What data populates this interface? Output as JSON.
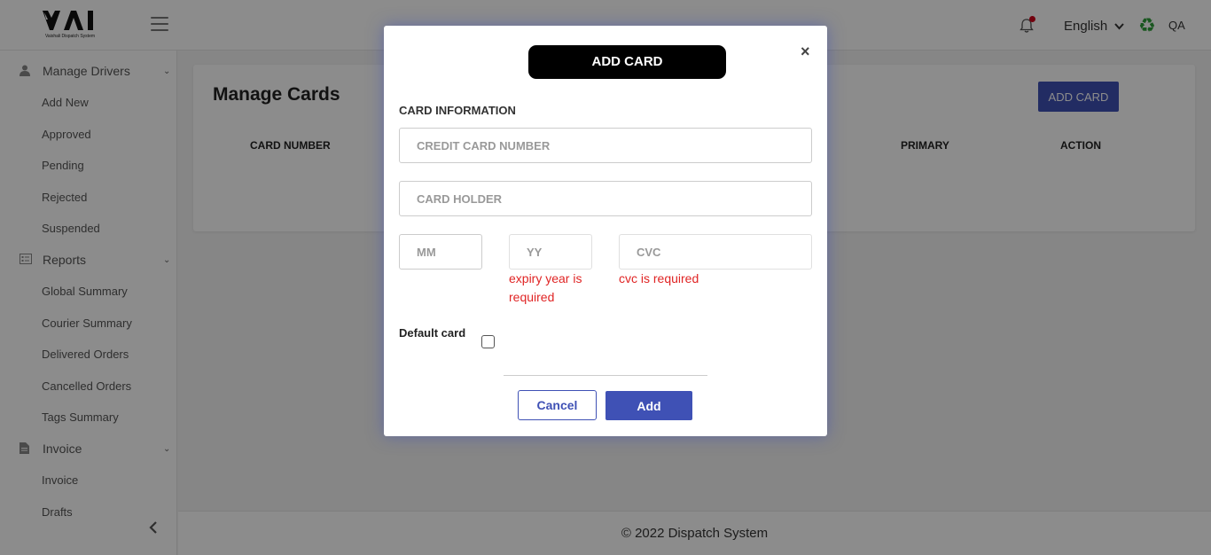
{
  "header": {
    "logo_text": "VAI",
    "logo_subtitle": "Vaishali Dispatch System",
    "language": "English",
    "user": "QA"
  },
  "sidebar": {
    "items": [
      {
        "label": "Manage Drivers",
        "type": "section",
        "icon": "user-icon"
      },
      {
        "label": "Add New",
        "type": "item"
      },
      {
        "label": "Approved",
        "type": "item"
      },
      {
        "label": "Pending",
        "type": "item"
      },
      {
        "label": "Rejected",
        "type": "item"
      },
      {
        "label": "Suspended",
        "type": "item"
      },
      {
        "label": "Reports",
        "type": "section",
        "icon": "report-icon"
      },
      {
        "label": "Global Summary",
        "type": "item"
      },
      {
        "label": "Courier Summary",
        "type": "item"
      },
      {
        "label": "Delivered Orders",
        "type": "item"
      },
      {
        "label": "Cancelled Orders",
        "type": "item"
      },
      {
        "label": "Tags Summary",
        "type": "item"
      },
      {
        "label": "Invoice",
        "type": "section",
        "icon": "invoice-icon"
      },
      {
        "label": "Invoice",
        "type": "item"
      },
      {
        "label": "Drafts",
        "type": "item"
      }
    ]
  },
  "page": {
    "title": "Manage Cards",
    "add_button": "ADD CARD",
    "columns": [
      "CARD NUMBER",
      "PRIMARY",
      "ACTION"
    ]
  },
  "modal": {
    "title": "ADD CARD",
    "close": "×",
    "section_label": "CARD INFORMATION",
    "card_number_placeholder": "CREDIT CARD NUMBER",
    "card_holder_placeholder": "CARD HOLDER",
    "mm_placeholder": "MM",
    "yy_placeholder": "YY",
    "cvc_placeholder": "CVC",
    "yy_error": "expiry year is required",
    "cvc_error": "cvc is required",
    "default_label": "Default card",
    "cancel": "Cancel",
    "add": "Add"
  },
  "footer": {
    "text": "© 2022 Dispatch System"
  }
}
